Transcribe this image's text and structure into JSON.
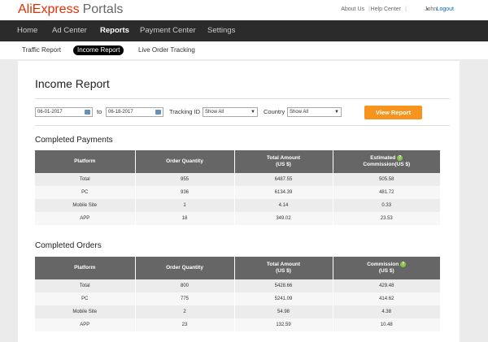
{
  "brand": {
    "ali": "Ali",
    "express": "Express",
    "portals": "Portals",
    "accent": "#e62e04"
  },
  "toplinks": {
    "about": "About Us",
    "help": "Help Center",
    "user": "John",
    "logout": "Logout"
  },
  "mainnav": [
    "Home",
    "Ad Center",
    "Reports",
    "Payment Center",
    "Settings"
  ],
  "mainnav_active": "Reports",
  "subnav": [
    "Traffic Report",
    "Income Report",
    "Live Order Tracking"
  ],
  "subnav_active": "Income Report",
  "page": {
    "title": "Income Report"
  },
  "filters": {
    "date_from": "06-01-2017",
    "to_label": "to",
    "date_to": "06-18-2017",
    "tracking_label": "Tracking ID",
    "tracking_value": "Show All",
    "country_label": "Country",
    "country_value": "Show All",
    "button": "View Report",
    "button_color": "#f7941d"
  },
  "completed_payments": {
    "title": "Completed Payments",
    "headers": {
      "platform": "Platform",
      "quantity": "Order Quantity",
      "amount_1": "Total Amount",
      "amount_2": "(US $)",
      "commission_1": "Estimated",
      "commission_2": "Commission(US $)"
    },
    "rows": [
      {
        "platform": "Total",
        "quantity": "955",
        "amount": "6487.55",
        "commission": "505.58"
      },
      {
        "platform": "PC",
        "quantity": "936",
        "amount": "6134.39",
        "commission": "481.72"
      },
      {
        "platform": "Mobile Site",
        "quantity": "1",
        "amount": "4.14",
        "commission": "0.33"
      },
      {
        "platform": "APP",
        "quantity": "18",
        "amount": "349.02",
        "commission": "23.53"
      }
    ]
  },
  "completed_orders": {
    "title": "Completed Orders",
    "headers": {
      "platform": "Platform",
      "quantity": "Order Quantity",
      "amount_1": "Total Amount",
      "amount_2": "(US $)",
      "commission_1": "Commission",
      "commission_2": "(US $)"
    },
    "rows": [
      {
        "platform": "Total",
        "quantity": "800",
        "amount": "5428.66",
        "commission": "429.48"
      },
      {
        "platform": "PC",
        "quantity": "775",
        "amount": "5241.09",
        "commission": "414.62"
      },
      {
        "platform": "Mobile Site",
        "quantity": "2",
        "amount": "54.98",
        "commission": "4.38"
      },
      {
        "platform": "APP",
        "quantity": "23",
        "amount": "132.59",
        "commission": "10.48"
      }
    ]
  },
  "icons": {
    "help": "question-circle-icon",
    "calendar": "calendar-icon",
    "dropdown": "chevron-down-icon"
  }
}
